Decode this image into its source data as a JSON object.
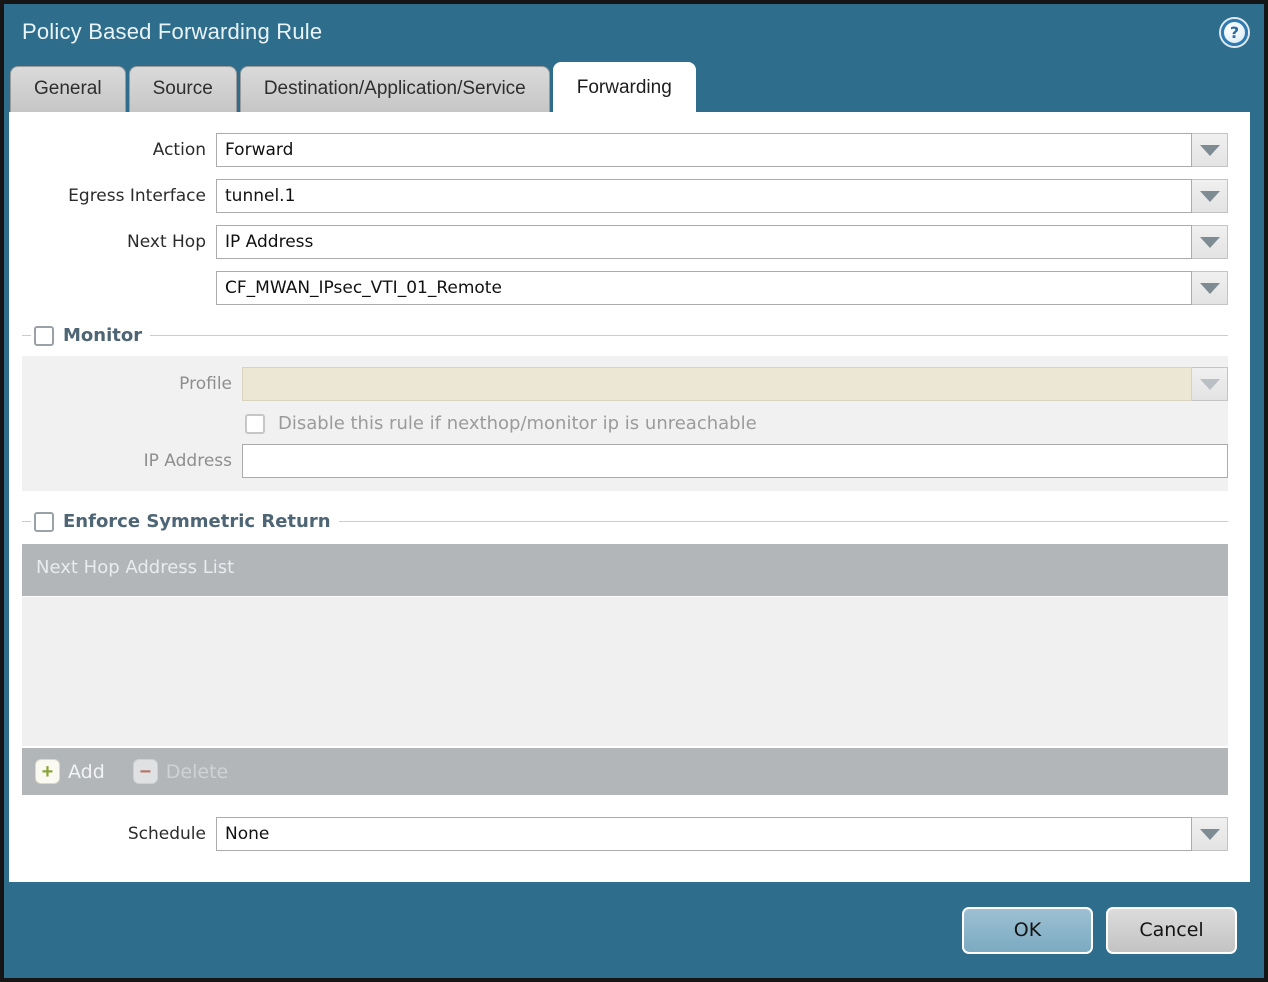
{
  "dialog": {
    "title": "Policy Based Forwarding Rule",
    "help_glyph": "?"
  },
  "tabs": [
    {
      "label": "General",
      "active": false
    },
    {
      "label": "Source",
      "active": false
    },
    {
      "label": "Destination/Application/Service",
      "active": false
    },
    {
      "label": "Forwarding",
      "active": true
    }
  ],
  "form": {
    "action": {
      "label": "Action",
      "value": "Forward"
    },
    "egress_interface": {
      "label": "Egress Interface",
      "value": "tunnel.1"
    },
    "next_hop": {
      "label": "Next Hop",
      "type_value": "IP Address",
      "address_value": "CF_MWAN_IPsec_VTI_01_Remote"
    },
    "monitor": {
      "label": "Monitor",
      "checked": false,
      "profile": {
        "label": "Profile",
        "value": ""
      },
      "disable_rule": {
        "label": "Disable this rule if nexthop/monitor ip is unreachable",
        "checked": false
      },
      "ip_address": {
        "label": "IP Address",
        "value": ""
      }
    },
    "enforce_symmetric_return": {
      "label": "Enforce Symmetric Return",
      "checked": false,
      "table": {
        "header": "Next Hop Address List",
        "rows": []
      },
      "add_label": "Add",
      "delete_label": "Delete",
      "add_glyph": "+",
      "delete_glyph": "−"
    },
    "schedule": {
      "label": "Schedule",
      "value": "None"
    }
  },
  "footer": {
    "ok_label": "OK",
    "cancel_label": "Cancel"
  },
  "colors": {
    "titlebar_teal": "#2f6d8c",
    "active_tab": "#ffffff",
    "inactive_tab": "#cecece",
    "table_header_gray": "#b2b6b9",
    "table_body_gray": "#f0f0f1",
    "disabled_field_beige": "#ece7d4",
    "ok_button_blue": "#7baac1",
    "cancel_button_gray": "#c3c3c3",
    "section_title_slate": "#4d6574"
  }
}
